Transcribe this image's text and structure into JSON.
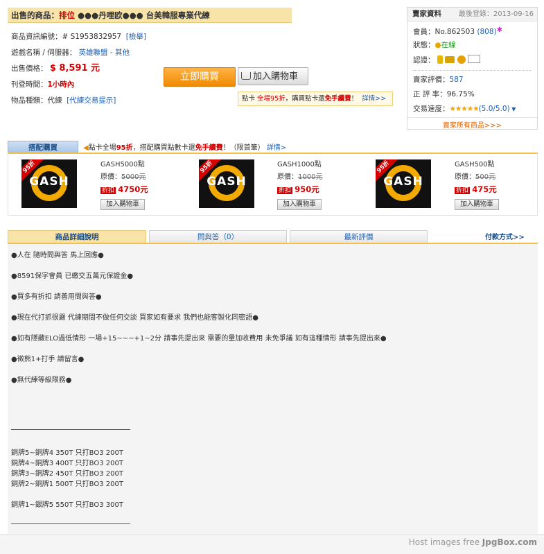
{
  "title": {
    "prefix": "出售的商品：",
    "tag": "排位",
    "text": "●●●丹哩欧●●● 台美韓服專業代練"
  },
  "info": {
    "id_label": "商品資訊編號：",
    "id_value": "# S1953832957",
    "report": "[檢舉]",
    "game_label": "遊戲名稱 / 伺服器：",
    "game_value": "英雄聯盟 - 其他",
    "price_label": "出售價格：",
    "price_value": "$ 8,591 元",
    "time_label": "刊登時間：",
    "time_value": "1小時內",
    "type_label": "物品種類：代練",
    "type_link": "[代練交易提示]"
  },
  "buttons": {
    "buy": "立即購買",
    "cart": "加入購物車"
  },
  "promo": {
    "prefix": "點卡",
    "highlight": "全場95折",
    "middle": "，購買點卡還",
    "free": "免手續費",
    "end": "！",
    "details": "詳情>>"
  },
  "seller": {
    "title": "賣家資料",
    "last_login": "最後登錄：2013-09-16",
    "member_label": "會員：",
    "member_value": "No.862503",
    "member_count": "(808)",
    "status_label": "狀態：",
    "status_value": "在線",
    "verify_label": "認證：",
    "rating_label": "賣家評價：",
    "rating_value": "587",
    "positive_label": "正 評 率：",
    "positive_value": "96.75%",
    "speed_label": "交易速度：",
    "speed_stars": "★★★★★",
    "speed_value": "(5.0/5.0)",
    "all_products": "賣家所有商品>>>"
  },
  "combo": {
    "tab": "搭配購買",
    "notice_prefix": "點卡全場",
    "notice_discount": "95折",
    "notice_mid": "，搭配購買點數卡還",
    "notice_free": "免手續費",
    "notice_end": "！（限首筆）",
    "notice_link": "詳情>",
    "badge": "95折",
    "logo_text": "GASH",
    "items": [
      {
        "name": "GASH5000點",
        "orig_label": "原價：",
        "orig_price": "5000元",
        "disc_label": "折扣",
        "disc_price": "4750元",
        "button": "加入購物車"
      },
      {
        "name": "GASH1000點",
        "orig_label": "原價：",
        "orig_price": "1000元",
        "disc_label": "折扣",
        "disc_price": "950元",
        "button": "加入購物車"
      },
      {
        "name": "GASH500點",
        "orig_label": "原價：",
        "orig_price": "500元",
        "disc_label": "折扣",
        "disc_price": "475元",
        "button": "加入購物車"
      }
    ]
  },
  "tabs": [
    "商品詳細說明",
    "問與答（0）",
    "最新評價"
  ],
  "payment_link": "付款方式>>",
  "description": {
    "lines": [
      "●人在 隨時問與答 馬上回應●",
      "●8591保字會員 已繳交五萬元保證金●",
      "●買多有折扣 請善用問與答●",
      "●現在代打抓很嚴 代練期間不做任何交談 買家如有要求 我們也能客製化同密語●",
      "●如有隱藏ELO過低情形 一場+15~~~+1~2分 請事先提出來 需要的量加收費用 未免爭議 如有這種情形 請事先提出來●",
      "●徵熊1+打手 請留言●",
      "●無代練等級限務●"
    ],
    "prices": [
      "銅牌5~銅牌4 350T 只打BO3 200T",
      "銅牌4~銅牌3 400T 只打BO3 200T",
      "銅牌3~銅牌2 450T 只打BO3 200T",
      "銅牌2~銅牌1 500T 只打BO3 200T",
      "銅牌1~銀牌5 550T 只打BO3 300T"
    ]
  },
  "footer": {
    "text": "Host images free",
    "brand": "JpgBox.com"
  }
}
